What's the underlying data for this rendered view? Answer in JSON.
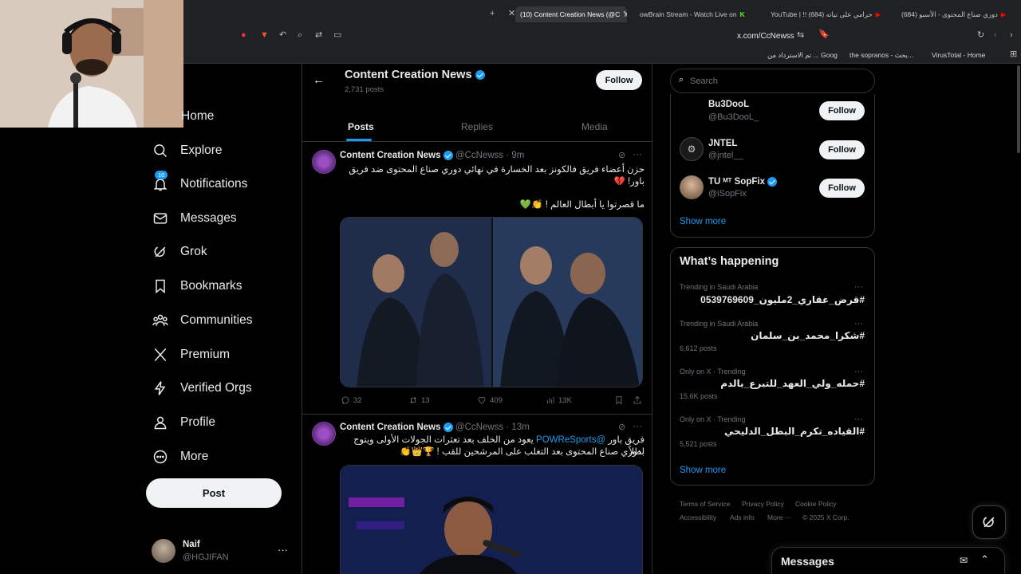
{
  "browser": {
    "tabs": [
      {
        "label": "(10) Content Creation News (@C"
      },
      {
        "label": "owBrain Stream - Watch Live on"
      },
      {
        "label": "YouTube | !! (684) حرامي على نياته"
      },
      {
        "label": "(684) دوري صناع المحتوى - الأسبو"
      }
    ],
    "url": "x.com/CcNewss",
    "bookmarks": [
      "the sopranos - بحث...",
      "تم الاسترداد من ... Goog",
      "VirusTotal - Home"
    ]
  },
  "nav": {
    "items": [
      {
        "label": "Home",
        "icon": "home-icon"
      },
      {
        "label": "Explore",
        "icon": "search-icon"
      },
      {
        "label": "Notifications",
        "icon": "bell-icon",
        "badge": "10"
      },
      {
        "label": "Messages",
        "icon": "mail-icon"
      },
      {
        "label": "Grok",
        "icon": "grok-icon"
      },
      {
        "label": "Bookmarks",
        "icon": "bookmark-icon"
      },
      {
        "label": "Communities",
        "icon": "people-icon"
      },
      {
        "label": "Premium",
        "icon": "x-logo-icon"
      },
      {
        "label": "Verified Orgs",
        "icon": "lightning-icon"
      },
      {
        "label": "Profile",
        "icon": "person-icon"
      },
      {
        "label": "More",
        "icon": "more-circle-icon"
      }
    ],
    "post_label": "Post",
    "account": {
      "name": "Naif",
      "handle": "@HGJIFAN"
    }
  },
  "profile": {
    "name": "Content Creation News",
    "posts": "2,731 posts",
    "follow_label": "Follow",
    "tabs": [
      "Posts",
      "Replies",
      "Media"
    ]
  },
  "tweets": [
    {
      "name": "Content Creation News",
      "handle": "@CcNewss",
      "time": "· 9m",
      "line1": "حزن أعضاء فريق فالكونز بعد الخسارة في نهائي دوري صناع المحتوى ضد فريق باور! 💔",
      "line2": "ما قصرتوا يا أبطال العالم ! 👏💚",
      "replies": "32",
      "reposts": "13",
      "likes": "409",
      "views": "13K"
    },
    {
      "name": "Content Creation News",
      "handle": "@CcNewss",
      "time": "· 13m",
      "mention": "@POWReSports",
      "line1_pre": "فريق باور",
      "line1_post": "يعود من الخلف بعد تعثرات الجولات الأولى ويتوج بطلاً",
      "line2": "لدوري صناع المحتوى بعد التغلب على المرشحين للقب ! 🏆👑👏"
    }
  ],
  "search": {
    "placeholder": "Search"
  },
  "suggestions": [
    {
      "name": "Bu3DooL",
      "handle": "@Bu3DooL_",
      "verified": false
    },
    {
      "name": "JNTEL",
      "handle": "@jntel__",
      "verified": false
    },
    {
      "name": "TU ᴹᵀ SopFix",
      "handle": "@iSopFix",
      "verified": true
    }
  ],
  "follow_label": "Follow",
  "show_more": "Show more",
  "trending": {
    "title": "What’s happening",
    "items": [
      {
        "meta": "Trending in Saudi Arabia",
        "name": "#قرض_عقاري_2مليون_0539769609",
        "count": ""
      },
      {
        "meta": "Trending in Saudi Arabia",
        "name": "#شكرا_محمد_بن_سلمان",
        "count": "6,612 posts"
      },
      {
        "meta": "Only on X · Trending",
        "name": "#حمله_ولي_العهد_للتبرع_بالدم",
        "count": "15.6K posts"
      },
      {
        "meta": "Only on X · Trending",
        "name": "#القياده_تكرم_البطل_الدليحي",
        "count": "5,521 posts"
      }
    ]
  },
  "footer": {
    "links": [
      "Terms of Service",
      "Privacy Policy",
      "Cookie Policy",
      "Accessibility",
      "Ads info",
      "More ···"
    ],
    "copyright": "© 2025 X Corp."
  },
  "messages_drawer": {
    "title": "Messages"
  },
  "colors": {
    "accent": "#1d9bf0",
    "background": "#000000",
    "border": "#2f3336",
    "muted": "#71767b"
  }
}
